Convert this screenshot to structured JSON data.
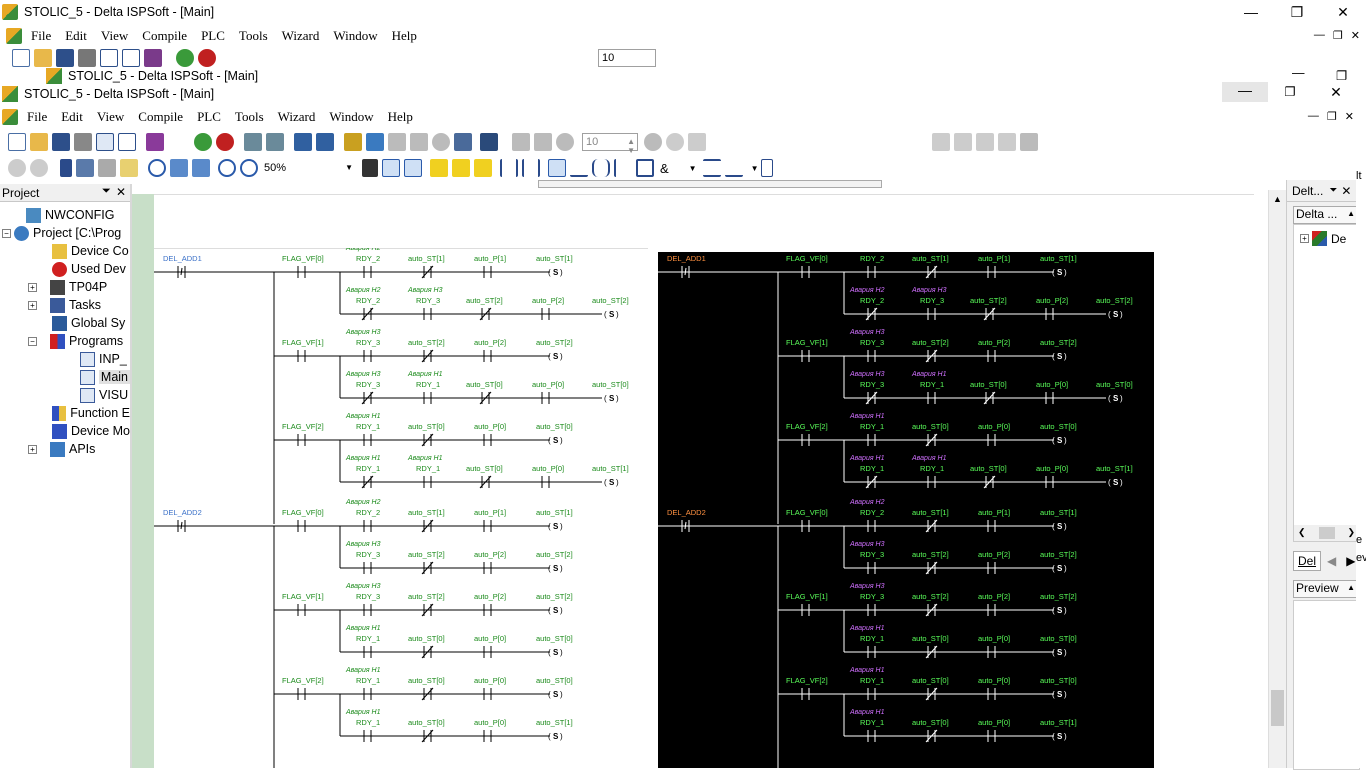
{
  "outer": {
    "title": "STOLIC_5 - Delta ISPSoft - [Main]",
    "menu": [
      "File",
      "Edit",
      "View",
      "Compile",
      "PLC",
      "Tools",
      "Wizard",
      "Window",
      "Help"
    ],
    "zoom_value": "10"
  },
  "inner": {
    "title_shadow": "STOLIC_5 - Delta ISPSoft - [Main]",
    "title": "STOLIC_5 - Delta ISPSoft - [Main]",
    "menu": [
      "File",
      "Edit",
      "View",
      "Compile",
      "PLC",
      "Tools",
      "Wizard",
      "Window",
      "Help"
    ],
    "scan_value": "10",
    "zoom": "50%",
    "and_symbol": "&"
  },
  "project_panel": {
    "title": "Project",
    "items": [
      {
        "label": "NWCONFIG",
        "icon": "network-icon"
      },
      {
        "label": "Project [C:\\Prog",
        "icon": "project-icon"
      },
      {
        "label": "Device Co",
        "icon": "device-config-icon"
      },
      {
        "label": "Used Dev",
        "icon": "used-device-icon"
      },
      {
        "label": "TP04P",
        "icon": "tp04p-icon"
      },
      {
        "label": "Tasks",
        "icon": "tasks-icon"
      },
      {
        "label": "Global Sy",
        "icon": "global-symbols-icon"
      },
      {
        "label": "Programs",
        "icon": "programs-icon"
      },
      {
        "label": "INP_",
        "icon": "pou-icon"
      },
      {
        "label": "Main",
        "icon": "pou-icon"
      },
      {
        "label": "VISU",
        "icon": "pou-icon"
      },
      {
        "label": "Function E",
        "icon": "function-block-icon"
      },
      {
        "label": "Device Mo",
        "icon": "device-monitor-icon"
      },
      {
        "label": "APIs",
        "icon": "apis-icon"
      }
    ]
  },
  "right_panel": {
    "title": "Delt...",
    "subtitle": "Delta ...",
    "tree_item": "De",
    "tab": "Del",
    "preview": "Preview",
    "edge_text_top": "lt",
    "edge_text_mid": "e",
    "edge_text_low": "ev"
  },
  "ladder": {
    "contacts": [
      "DEL_ADD1",
      "DEL_ADD2"
    ],
    "branches": [
      {
        "flag": "FLAG_VF[0]",
        "c1": "Авария H2",
        "c2": "",
        "r1": "RDY_2",
        "r2": "",
        "s": "auto_ST[1]",
        "p": "auto_P[1]",
        "coil": "auto_ST[1]",
        "inv": false
      },
      {
        "flag": "",
        "c1": "Авария H2",
        "c2": "Авария H3",
        "r1": "RDY_2",
        "r2": "RDY_3",
        "s": "auto_ST[2]",
        "p": "auto_P[2]",
        "coil": "auto_ST[2]",
        "inv": true
      },
      {
        "flag": "FLAG_VF[1]",
        "c1": "Авария H3",
        "c2": "",
        "r1": "RDY_3",
        "r2": "",
        "s": "auto_ST[2]",
        "p": "auto_P[2]",
        "coil": "auto_ST[2]",
        "inv": false
      },
      {
        "flag": "",
        "c1": "Авария H3",
        "c2": "Авария H1",
        "r1": "RDY_3",
        "r2": "RDY_1",
        "s": "auto_ST[0]",
        "p": "auto_P[0]",
        "coil": "auto_ST[0]",
        "inv": true
      },
      {
        "flag": "FLAG_VF[2]",
        "c1": "Авария H1",
        "c2": "",
        "r1": "RDY_1",
        "r2": "",
        "s": "auto_ST[0]",
        "p": "auto_P[0]",
        "coil": "auto_ST[0]",
        "inv": false
      },
      {
        "flag": "",
        "c1": "Авария H1",
        "c2": "Авария H1",
        "r1": "RDY_1",
        "r2": "RDY_1",
        "s": "auto_ST[0]",
        "p": "auto_P[0]",
        "coil": "auto_ST[1]",
        "inv": true
      }
    ],
    "branches2": [
      {
        "flag": "FLAG_VF[0]",
        "c1": "Авария H2",
        "r1": "RDY_2",
        "s": "auto_ST[1]",
        "p": "auto_P[1]",
        "coil": "auto_ST[1]"
      },
      {
        "flag": "",
        "c1": "Авария H3",
        "r1": "RDY_3",
        "s": "auto_ST[2]",
        "p": "auto_P[2]",
        "coil": "auto_ST[2]"
      },
      {
        "flag": "FLAG_VF[1]",
        "c1": "Авария H3",
        "r1": "RDY_3",
        "s": "auto_ST[2]",
        "p": "auto_P[2]",
        "coil": "auto_ST[2]"
      },
      {
        "flag": "",
        "c1": "Авария H1",
        "r1": "RDY_1",
        "s": "auto_ST[0]",
        "p": "auto_P[0]",
        "coil": "auto_ST[0]"
      },
      {
        "flag": "FLAG_VF[2]",
        "c1": "Авария H1",
        "r1": "RDY_1",
        "s": "auto_ST[0]",
        "p": "auto_P[0]",
        "coil": "auto_ST[0]"
      },
      {
        "flag": "",
        "c1": "Авария H1",
        "r1": "RDY_1",
        "s": "auto_ST[0]",
        "p": "auto_P[0]",
        "coil": "auto_ST[1]"
      }
    ],
    "coil_symbol": "S"
  }
}
